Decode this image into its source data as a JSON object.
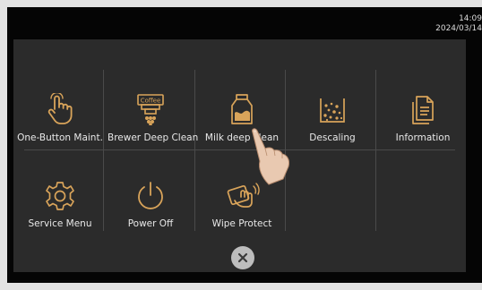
{
  "status": {
    "time": "14:09",
    "date": "2024/03/14"
  },
  "menu": {
    "items": [
      {
        "label": "One-Button Maint.",
        "icon": "hand-pointer-icon"
      },
      {
        "label": "Brewer Deep Clean",
        "icon": "coffee-brewer-icon"
      },
      {
        "label": "Milk deep clean",
        "icon": "milk-carton-icon"
      },
      {
        "label": "Descaling",
        "icon": "descaling-icon"
      },
      {
        "label": "Information",
        "icon": "document-icon"
      },
      {
        "label": "Service Menu",
        "icon": "gear-icon"
      },
      {
        "label": "Power Off",
        "icon": "power-icon"
      },
      {
        "label": "Wipe Protect",
        "icon": "wipe-icon"
      }
    ],
    "brewer_icon_text": "Coffee"
  },
  "close": {
    "icon": "close-icon"
  },
  "colors": {
    "accent": "#d9a45a",
    "panel": "#2b2b2b",
    "background": "#050505"
  }
}
